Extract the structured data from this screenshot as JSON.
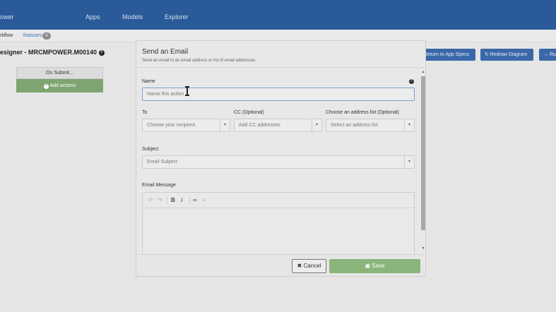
{
  "topnav": {
    "brand": "ower",
    "items": [
      "Apps",
      "Models",
      "Explorer"
    ]
  },
  "subtabs": {
    "workflow": "rkflow",
    "statuses": "Statuses",
    "statuses_count": "6"
  },
  "designer": {
    "title": "esigner - MRCMPOWER.M00140",
    "help_icon": "?"
  },
  "canvas": {
    "on_submit": "On Submit...",
    "add_actions": "Add actions"
  },
  "toolbar": {
    "return_label": "Return to App Specs",
    "redraw_label": "Redraw Diagram",
    "run_label": "Ru"
  },
  "modal": {
    "title": "Send an Email",
    "subtitle": "Send an email to an email address or list of email addresses",
    "name_label": "Name",
    "name_placeholder": "Name this action",
    "to_label": "To",
    "to_placeholder": "Choose your recipient",
    "cc_label": "CC (Optional)",
    "cc_placeholder": "Add CC addresses",
    "list_label": "Choose an address list (Optional)",
    "list_placeholder": "Select an address list",
    "subject_label": "Subject",
    "subject_placeholder": "Email Subject",
    "message_label": "Email Message",
    "cancel_label": "Cancel",
    "save_label": "Save"
  },
  "colors": {
    "nav": "#2a5a9a",
    "primary_button": "#3a68a8",
    "success": "#8ab57a"
  }
}
